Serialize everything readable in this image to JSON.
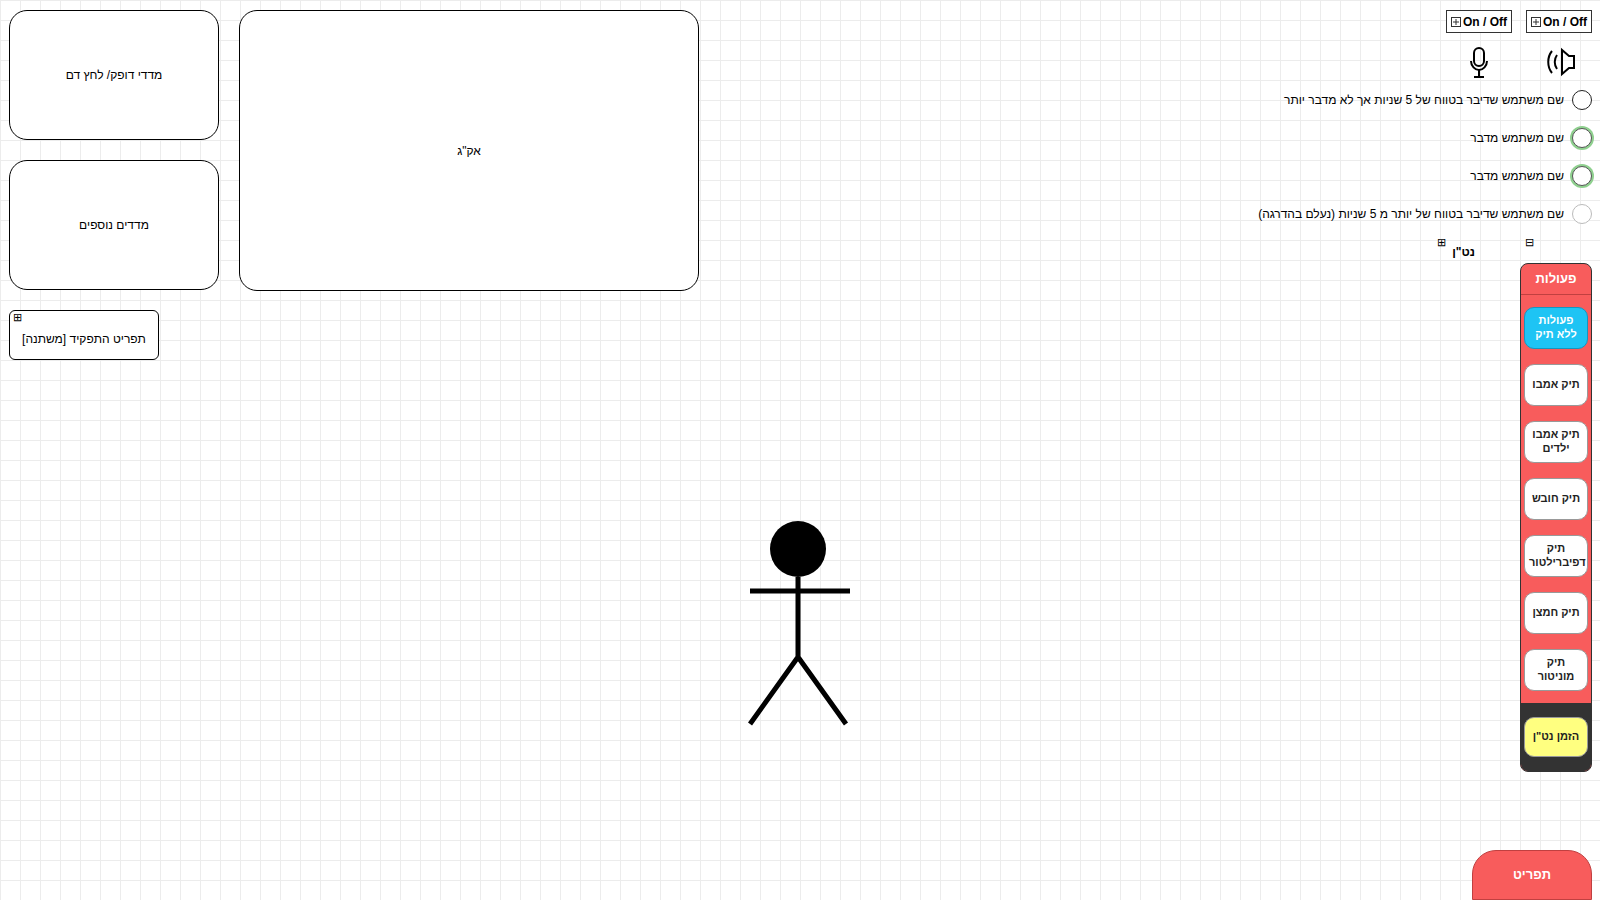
{
  "panels": {
    "vitals": "מדדי דופק/ לחץ דם",
    "extra": "מדדים נוספים",
    "ecg": "אק\"ג"
  },
  "role_menu": {
    "label": "תפריט התפקיד [משתנה]",
    "expand_icon": "⊞"
  },
  "audio_toggles": [
    {
      "label": "On / Off",
      "device": "mic"
    },
    {
      "label": "On / Off",
      "device": "speaker"
    }
  ],
  "speakers": [
    {
      "name": "שם משתמש שדיבר בטווח של 5 שניות אך לא מדבר יותר",
      "kind": "recent"
    },
    {
      "name": "שם משתמש מדבר",
      "kind": "speaking"
    },
    {
      "name": "שם משתמש מדבר",
      "kind": "speaking"
    },
    {
      "name": "שם משתמש שדיבר בטווח של יותר מ 5 שניות (נעלם בהדרגה)",
      "kind": "faded"
    }
  ],
  "team": {
    "label": "נט\"ן",
    "expand_icon": "⊞",
    "collapse_icon": "⊟"
  },
  "actions": {
    "title": "פעולות",
    "items": [
      {
        "label": "פעולות ללא תיק",
        "selected": true
      },
      {
        "label": "תיק אמבו",
        "selected": false
      },
      {
        "label": "תיק אמבו ילדים",
        "selected": false
      },
      {
        "label": "תיק חובש",
        "selected": false
      },
      {
        "label": "תיק דפיברילטור",
        "selected": false
      },
      {
        "label": "תיק חמצן",
        "selected": false
      },
      {
        "label": "תיק מוניטור",
        "selected": false
      }
    ],
    "call": "הזמן נט\"ן"
  },
  "menu_tab": "תפריט"
}
